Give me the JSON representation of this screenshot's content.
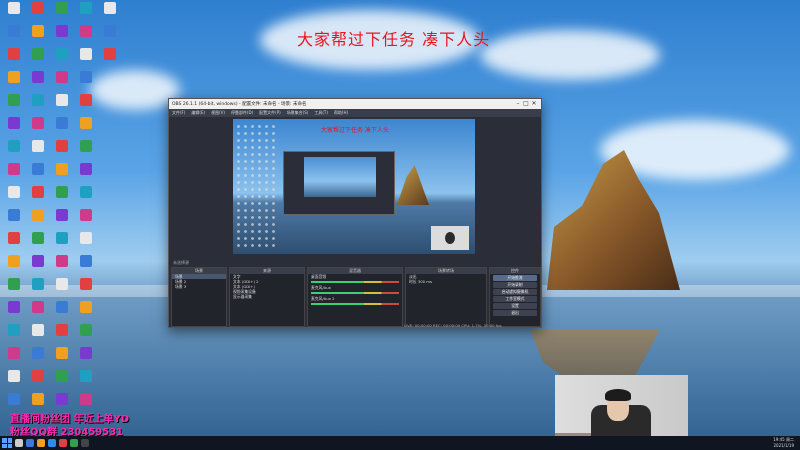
{
  "wallpaper": {
    "title": "大家帮过下任务 凑下人头",
    "bottom_line_1": "直播间粉丝团 年近上单YD",
    "bottom_line_2": "粉丝QQ群 230459531"
  },
  "obs": {
    "window_title": "OBS 26.1.1 (64-bit, windows) - 配置文件: 未命名 - 场景: 未命名",
    "menu": [
      "文件(F)",
      "编辑(E)",
      "视图(V)",
      "停靠部件(D)",
      "配置文件(P)",
      "场景集合(S)",
      "工具(T)",
      "帮助(H)"
    ],
    "preview_title": "大家帮过下任务 凑下人头",
    "no_source_label": "未选择源",
    "scenes": {
      "header": "场景",
      "items": [
        "场景",
        "场景 2",
        "场景 3"
      ]
    },
    "sources": {
      "header": "来源",
      "items": [
        "文字",
        "文本 (GDI+) 2",
        "文本 (GDI+)",
        "视频采集设备",
        "显示器采集"
      ]
    },
    "mixer": {
      "header": "混音器",
      "channels": [
        "桌面音频",
        "麦克风/Aux",
        "麦克风/Aux 2"
      ]
    },
    "transitions": {
      "header": "场景转场",
      "type": "淡出",
      "duration_label": "时长",
      "duration_value": "300 ms"
    },
    "controls": {
      "header": "控件",
      "buttons": [
        "开始推流",
        "开始录制",
        "启动虚拟摄像机",
        "工作室模式",
        "设置",
        "退出"
      ]
    },
    "status": "LIVE: 00:00:00   REC: 00:00:00   CPU: 1.7%, 30.00 fps"
  },
  "taskbar": {
    "time": "19:45 周二",
    "date": "2021/1/19"
  },
  "colors": {
    "title_red": "#e8141e",
    "bottom_text": "#ff2ab0",
    "obs_bg": "#2b2e38"
  }
}
